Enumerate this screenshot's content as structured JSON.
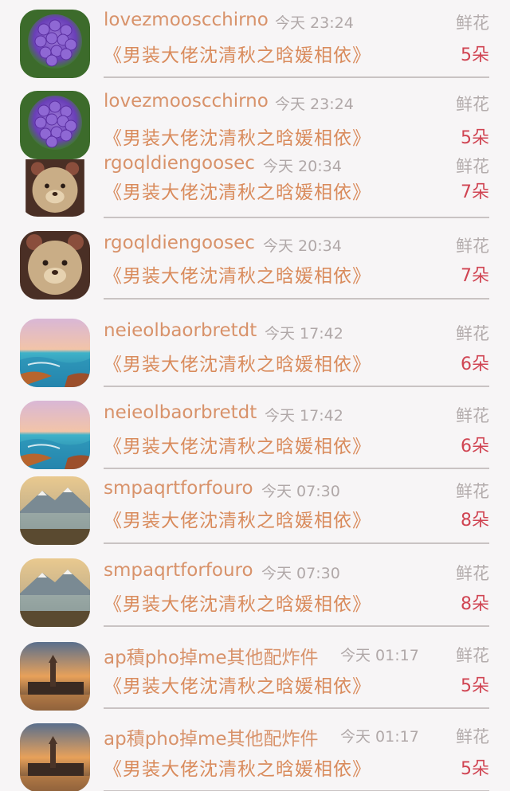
{
  "gift_label": "鲜花",
  "book_title": "《男装大佬沈清秋之晗媛相依》",
  "entries": [
    {
      "user": "lovezmooscchirno",
      "time": "今天 23:24",
      "count": "5朵",
      "avatar": "hydrangea-avatar"
    },
    {
      "user": "lovezmooscchirno",
      "time": "今天 23:24",
      "count": "5朵",
      "avatar": "hydrangea-avatar"
    },
    {
      "user": "rgoqldiengoosec",
      "time": "今天 20:34",
      "count": "7朵",
      "avatar": "bear-avatar"
    },
    {
      "user": "rgoqldiengoosec",
      "time": "今天 20:34",
      "count": "7朵",
      "avatar": "bear-avatar"
    },
    {
      "user": "neieolbaorbretdt",
      "time": "今天 17:42",
      "count": "6朵",
      "avatar": "seascape-avatar"
    },
    {
      "user": "neieolbaorbretdt",
      "time": "今天 17:42",
      "count": "6朵",
      "avatar": "seascape-avatar"
    },
    {
      "user": "smpaqrtforfouro",
      "time": "今天 07:30",
      "count": "8朵",
      "avatar": "mountain-lake-avatar"
    },
    {
      "user": "smpaqrtforfouro",
      "time": "今天 07:30",
      "count": "8朵",
      "avatar": "mountain-lake-avatar"
    },
    {
      "user": "ap積pho掉me其他配炸件",
      "time": "今天 01:17",
      "count": "5朵",
      "avatar": "city-sunset-avatar"
    },
    {
      "user": "ap積pho掉me其他配炸件",
      "time": "今天 01:17",
      "count": "5朵",
      "avatar": "city-sunset-avatar"
    }
  ]
}
